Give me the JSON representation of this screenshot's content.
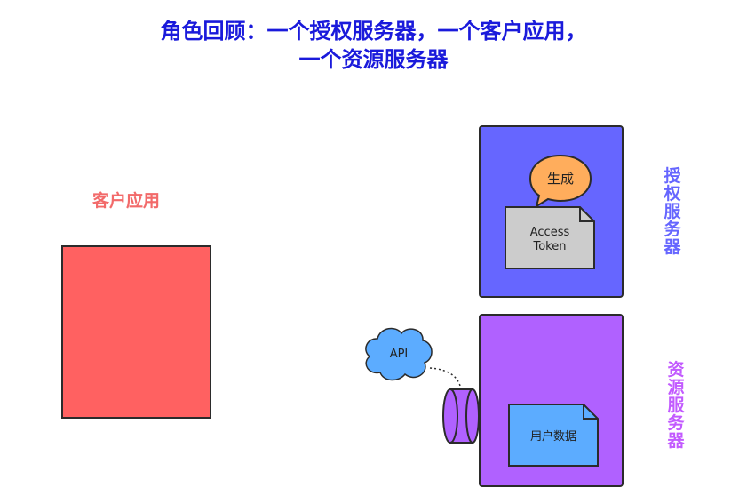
{
  "title": {
    "line1": "角色回顾：一个授权服务器，一个客户应用，",
    "line2": "一个资源服务器"
  },
  "client_app": {
    "label": "客户应用",
    "color": "#ff6161"
  },
  "auth_server": {
    "label": "授权服务器",
    "color": "#6666ff",
    "speech_bubble": "生成",
    "token_line1": "Access",
    "token_line2": "Token"
  },
  "resource_server": {
    "label": "资源服务器",
    "color": "#b061ff",
    "api_cloud": "API",
    "user_data": "用户数据"
  },
  "colors": {
    "title": "#1a1adb",
    "client_label": "#f26a6a",
    "auth_label": "#6666ff",
    "resource_label": "#c25aff",
    "bubble": "#ffad5c",
    "token_doc": "#cccccc",
    "cloud": "#5cacff",
    "user_data_doc": "#5cacff"
  }
}
